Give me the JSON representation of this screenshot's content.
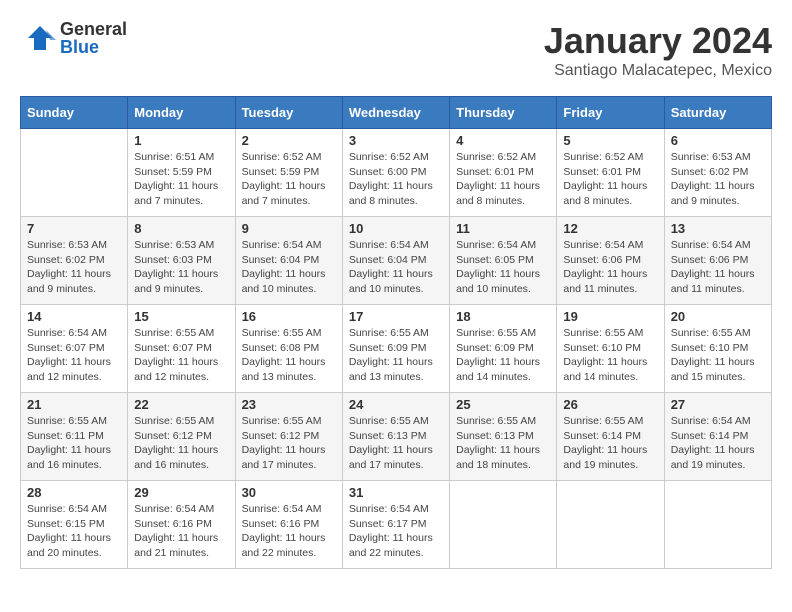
{
  "logo": {
    "general": "General",
    "blue": "Blue"
  },
  "title": "January 2024",
  "subtitle": "Santiago Malacatepec, Mexico",
  "days_of_week": [
    "Sunday",
    "Monday",
    "Tuesday",
    "Wednesday",
    "Thursday",
    "Friday",
    "Saturday"
  ],
  "weeks": [
    [
      {
        "day": "",
        "info": ""
      },
      {
        "day": "1",
        "info": "Sunrise: 6:51 AM\nSunset: 5:59 PM\nDaylight: 11 hours\nand 7 minutes."
      },
      {
        "day": "2",
        "info": "Sunrise: 6:52 AM\nSunset: 5:59 PM\nDaylight: 11 hours\nand 7 minutes."
      },
      {
        "day": "3",
        "info": "Sunrise: 6:52 AM\nSunset: 6:00 PM\nDaylight: 11 hours\nand 8 minutes."
      },
      {
        "day": "4",
        "info": "Sunrise: 6:52 AM\nSunset: 6:01 PM\nDaylight: 11 hours\nand 8 minutes."
      },
      {
        "day": "5",
        "info": "Sunrise: 6:52 AM\nSunset: 6:01 PM\nDaylight: 11 hours\nand 8 minutes."
      },
      {
        "day": "6",
        "info": "Sunrise: 6:53 AM\nSunset: 6:02 PM\nDaylight: 11 hours\nand 9 minutes."
      }
    ],
    [
      {
        "day": "7",
        "info": "Sunrise: 6:53 AM\nSunset: 6:02 PM\nDaylight: 11 hours\nand 9 minutes."
      },
      {
        "day": "8",
        "info": "Sunrise: 6:53 AM\nSunset: 6:03 PM\nDaylight: 11 hours\nand 9 minutes."
      },
      {
        "day": "9",
        "info": "Sunrise: 6:54 AM\nSunset: 6:04 PM\nDaylight: 11 hours\nand 10 minutes."
      },
      {
        "day": "10",
        "info": "Sunrise: 6:54 AM\nSunset: 6:04 PM\nDaylight: 11 hours\nand 10 minutes."
      },
      {
        "day": "11",
        "info": "Sunrise: 6:54 AM\nSunset: 6:05 PM\nDaylight: 11 hours\nand 10 minutes."
      },
      {
        "day": "12",
        "info": "Sunrise: 6:54 AM\nSunset: 6:06 PM\nDaylight: 11 hours\nand 11 minutes."
      },
      {
        "day": "13",
        "info": "Sunrise: 6:54 AM\nSunset: 6:06 PM\nDaylight: 11 hours\nand 11 minutes."
      }
    ],
    [
      {
        "day": "14",
        "info": "Sunrise: 6:54 AM\nSunset: 6:07 PM\nDaylight: 11 hours\nand 12 minutes."
      },
      {
        "day": "15",
        "info": "Sunrise: 6:55 AM\nSunset: 6:07 PM\nDaylight: 11 hours\nand 12 minutes."
      },
      {
        "day": "16",
        "info": "Sunrise: 6:55 AM\nSunset: 6:08 PM\nDaylight: 11 hours\nand 13 minutes."
      },
      {
        "day": "17",
        "info": "Sunrise: 6:55 AM\nSunset: 6:09 PM\nDaylight: 11 hours\nand 13 minutes."
      },
      {
        "day": "18",
        "info": "Sunrise: 6:55 AM\nSunset: 6:09 PM\nDaylight: 11 hours\nand 14 minutes."
      },
      {
        "day": "19",
        "info": "Sunrise: 6:55 AM\nSunset: 6:10 PM\nDaylight: 11 hours\nand 14 minutes."
      },
      {
        "day": "20",
        "info": "Sunrise: 6:55 AM\nSunset: 6:10 PM\nDaylight: 11 hours\nand 15 minutes."
      }
    ],
    [
      {
        "day": "21",
        "info": "Sunrise: 6:55 AM\nSunset: 6:11 PM\nDaylight: 11 hours\nand 16 minutes."
      },
      {
        "day": "22",
        "info": "Sunrise: 6:55 AM\nSunset: 6:12 PM\nDaylight: 11 hours\nand 16 minutes."
      },
      {
        "day": "23",
        "info": "Sunrise: 6:55 AM\nSunset: 6:12 PM\nDaylight: 11 hours\nand 17 minutes."
      },
      {
        "day": "24",
        "info": "Sunrise: 6:55 AM\nSunset: 6:13 PM\nDaylight: 11 hours\nand 17 minutes."
      },
      {
        "day": "25",
        "info": "Sunrise: 6:55 AM\nSunset: 6:13 PM\nDaylight: 11 hours\nand 18 minutes."
      },
      {
        "day": "26",
        "info": "Sunrise: 6:55 AM\nSunset: 6:14 PM\nDaylight: 11 hours\nand 19 minutes."
      },
      {
        "day": "27",
        "info": "Sunrise: 6:54 AM\nSunset: 6:14 PM\nDaylight: 11 hours\nand 19 minutes."
      }
    ],
    [
      {
        "day": "28",
        "info": "Sunrise: 6:54 AM\nSunset: 6:15 PM\nDaylight: 11 hours\nand 20 minutes."
      },
      {
        "day": "29",
        "info": "Sunrise: 6:54 AM\nSunset: 6:16 PM\nDaylight: 11 hours\nand 21 minutes."
      },
      {
        "day": "30",
        "info": "Sunrise: 6:54 AM\nSunset: 6:16 PM\nDaylight: 11 hours\nand 22 minutes."
      },
      {
        "day": "31",
        "info": "Sunrise: 6:54 AM\nSunset: 6:17 PM\nDaylight: 11 hours\nand 22 minutes."
      },
      {
        "day": "",
        "info": ""
      },
      {
        "day": "",
        "info": ""
      },
      {
        "day": "",
        "info": ""
      }
    ]
  ]
}
